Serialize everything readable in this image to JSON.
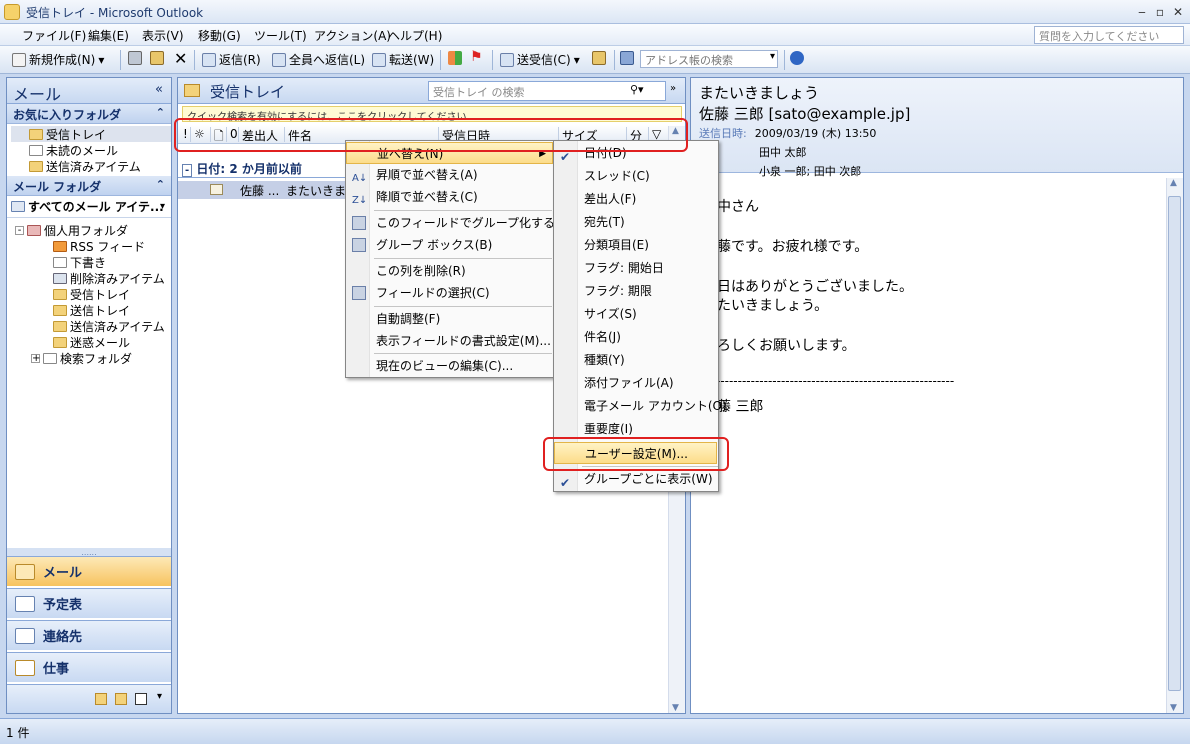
{
  "window": {
    "title": "受信トレイ - Microsoft Outlook",
    "controls": [
      "‒",
      "▫",
      "✕"
    ]
  },
  "menubar": {
    "items": [
      "ファイル(F)",
      "編集(E)",
      "表示(V)",
      "移動(G)",
      "ツール(T)",
      "アクション(A)",
      "ヘルプ(H)"
    ],
    "ask_placeholder": "質問を入力してください"
  },
  "toolbar": {
    "new": "新規作成(N)",
    "reply": "返信(R)",
    "reply_all": "全員へ返信(L)",
    "forward": "転送(W)",
    "send_receive": "送受信(C)",
    "address_placeholder": "アドレス帳の検索"
  },
  "nav": {
    "header": "メール",
    "favorites_header": "お気に入りフォルダ",
    "favorites": [
      "受信トレイ",
      "未読のメール",
      "送信済みアイテム"
    ],
    "mail_folders_header": "メール フォルダ",
    "all_mail": "すべてのメール アイテ...",
    "personal_root": "個人用フォルダ",
    "folders": [
      "RSS フィード",
      "下書き",
      "削除済みアイテム",
      "受信トレイ",
      "送信トレイ",
      "送信済みアイテム",
      "迷惑メール",
      "検索フォルダ"
    ],
    "buttons": [
      "メール",
      "予定表",
      "連絡先",
      "仕事"
    ]
  },
  "list": {
    "title": "受信トレイ",
    "search_placeholder": "受信トレイ の検索",
    "quick_search_tip": "クイック検索を有効にするには、ここをクリックしてください",
    "columns": [
      "!",
      "☼",
      "🗋",
      "0",
      "差出人",
      "件名",
      "受信日時",
      "サイズ",
      "分",
      "▽"
    ],
    "group_label": "日付: 2 か月前以前",
    "message": {
      "from": "佐藤 ...",
      "subject": "またいきまし..."
    }
  },
  "context_menu": {
    "items": [
      "並べ替え(N)",
      "昇順で並べ替え(A)",
      "降順で並べ替え(C)",
      "このフィールドでグループ化する(G)",
      "グループ ボックス(B)",
      "この列を削除(R)",
      "フィールドの選択(C)",
      "自動調整(F)",
      "表示フィールドの書式設定(M)...",
      "現在のビューの編集(C)..."
    ]
  },
  "sort_submenu": {
    "items": [
      "日付(D)",
      "スレッド(C)",
      "差出人(F)",
      "宛先(T)",
      "分類項目(E)",
      "フラグ: 開始日",
      "フラグ: 期限",
      "サイズ(S)",
      "件名(J)",
      "種類(Y)",
      "添付ファイル(A)",
      "電子メール アカウント(O)",
      "重要度(I)",
      "ユーザー設定(M)...",
      "グループごとに表示(W)"
    ]
  },
  "reading": {
    "subject": "またいきましょう",
    "from": "佐藤 三郎 [sato@example.jp]",
    "sent_label": "送信日時:",
    "sent_value": "2009/03/19 (木) 13:50",
    "to_value": "田中 太郎",
    "cc_value": "小泉 一郎; 田中 次郎",
    "body": [
      "田中さん",
      "佐藤です。お疲れ様です。",
      "先日はありがとうございました。",
      "またいきましょう。",
      "よろしくお願いします。",
      "----------------------------------------------------------",
      "佐藤 三郎"
    ]
  },
  "status": {
    "count": "1 件"
  }
}
